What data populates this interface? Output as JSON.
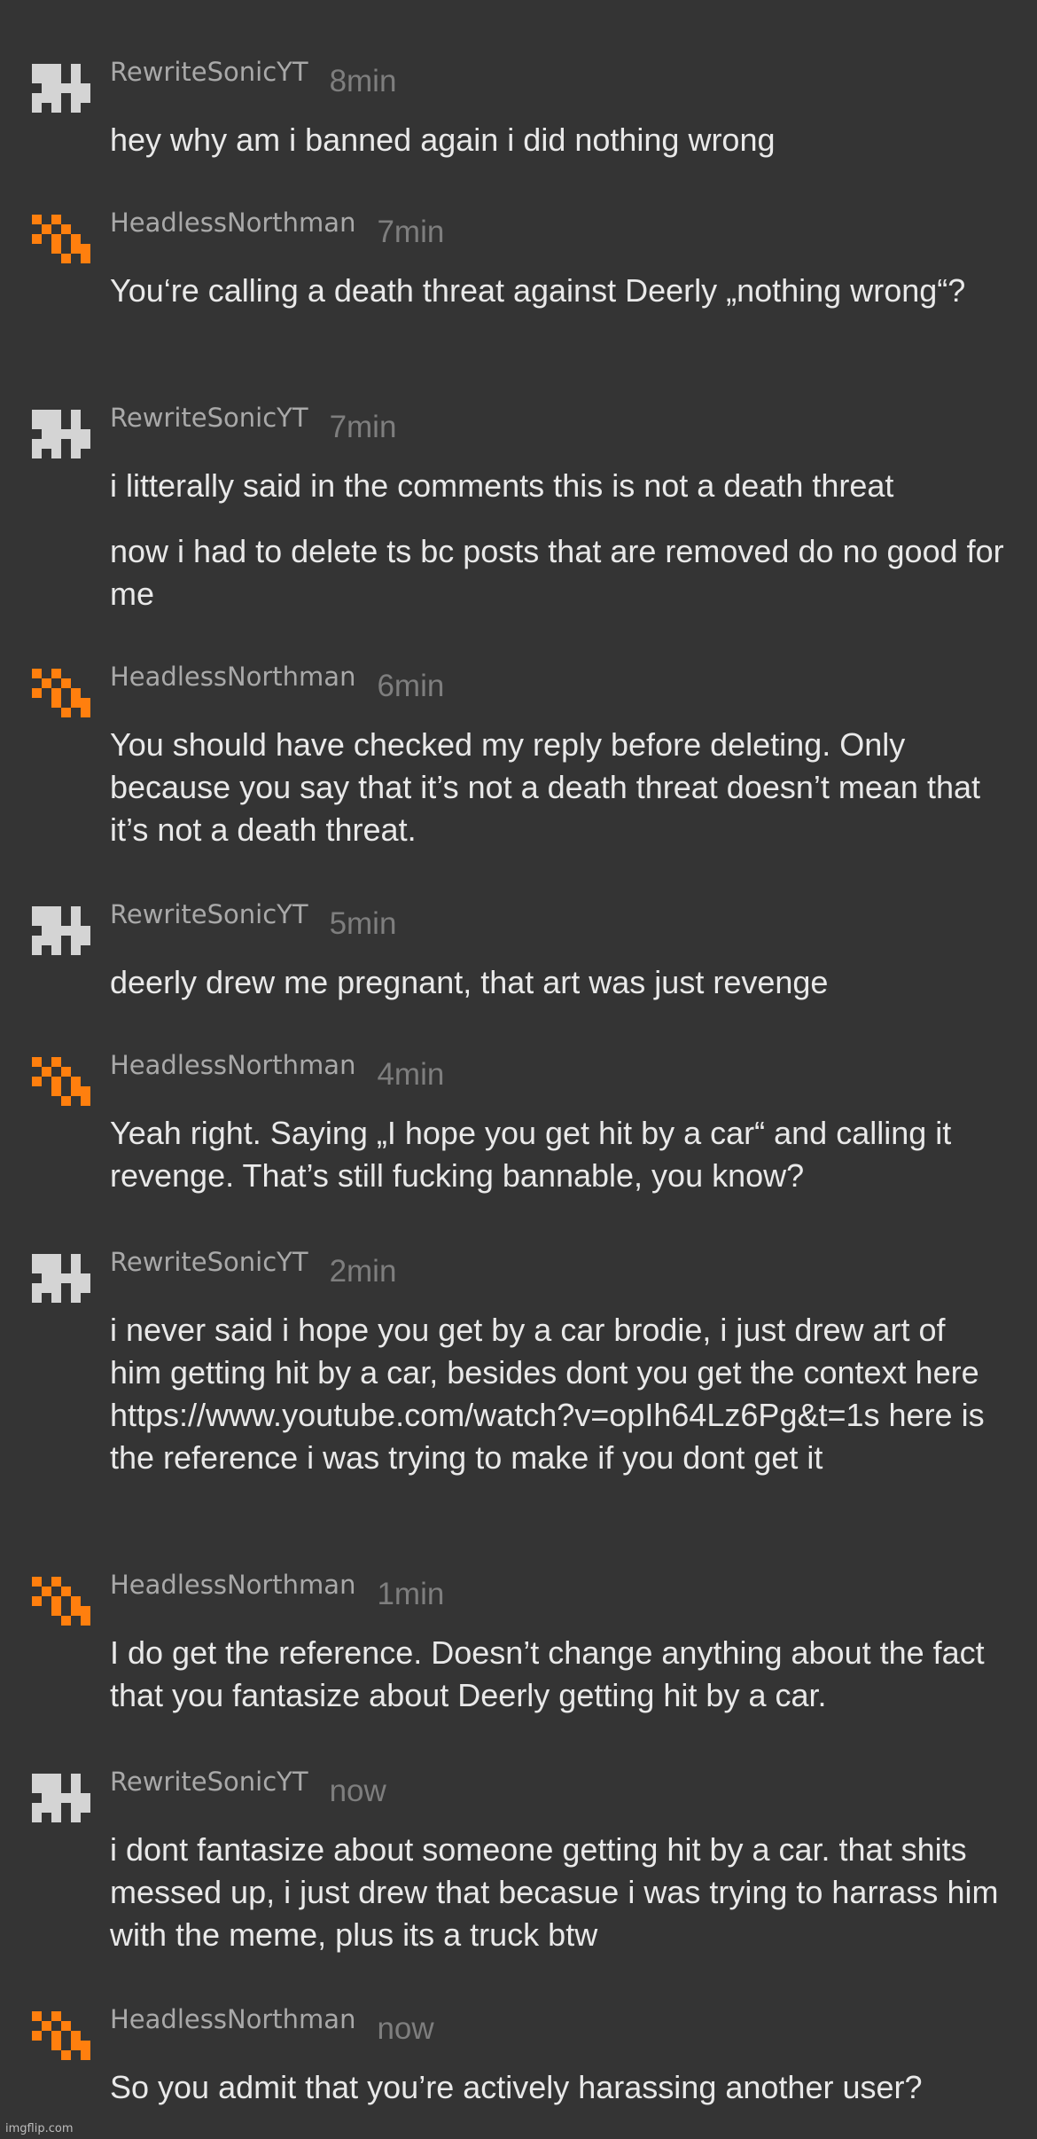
{
  "colors": {
    "background": "#343434",
    "username": "#a9a9a9",
    "timestamp": "#7e7e7e",
    "text": "#e9e9e9",
    "avatar_gray": "#d4d4d4",
    "avatar_orange": "#ff7f0e"
  },
  "comments": [
    {
      "user": "RewriteSonicYT",
      "time": "8min",
      "avatar_icon": "gray-pixel-avatar-icon",
      "paragraphs": [
        "hey why am i banned again i did nothing wrong"
      ]
    },
    {
      "user": "HeadlessNorthman",
      "time": "7min",
      "avatar_icon": "orange-pixel-avatar-icon",
      "paragraphs": [
        "You‘re calling a death threat against Deerly „nothing wrong“?"
      ]
    },
    {
      "user": "RewriteSonicYT",
      "time": "7min",
      "avatar_icon": "gray-pixel-avatar-icon",
      "paragraphs": [
        "i litterally said in the comments this is not a death threat",
        "now i had to delete ts bc posts that are removed do no good for me"
      ]
    },
    {
      "user": "HeadlessNorthman",
      "time": "6min",
      "avatar_icon": "orange-pixel-avatar-icon",
      "paragraphs": [
        "You should have checked my reply before deleting. Only because you say that it’s not a death threat doesn’t mean that it’s not a death threat."
      ]
    },
    {
      "user": "RewriteSonicYT",
      "time": "5min",
      "avatar_icon": "gray-pixel-avatar-icon",
      "paragraphs": [
        "deerly drew me pregnant, that art was just revenge"
      ]
    },
    {
      "user": "HeadlessNorthman",
      "time": "4min",
      "avatar_icon": "orange-pixel-avatar-icon",
      "paragraphs": [
        "Yeah right. Saying „I hope you get hit by a car“ and calling it revenge. That’s still fucking bannable, you know?"
      ]
    },
    {
      "user": "RewriteSonicYT",
      "time": "2min",
      "avatar_icon": "gray-pixel-avatar-icon",
      "paragraphs": [
        "i never said i hope you get by a car brodie, i just drew art of him getting hit by a car, besides dont you get the context here https://www.youtube.com/watch?v=opIh64Lz6Pg&t=1s here is the reference i was trying to make if you dont get it"
      ]
    },
    {
      "user": "HeadlessNorthman",
      "time": "1min",
      "avatar_icon": "orange-pixel-avatar-icon",
      "paragraphs": [
        "I do get the reference. Doesn’t change anything about the fact that you fantasize about Deerly getting hit by a car."
      ]
    },
    {
      "user": "RewriteSonicYT",
      "time": "now",
      "avatar_icon": "gray-pixel-avatar-icon",
      "paragraphs": [
        "i dont fantasize about someone getting hit by a car. that shits messed up, i just drew that becasue i was trying to harrass him with the meme, plus its a truck btw"
      ]
    },
    {
      "user": "HeadlessNorthman",
      "time": "now",
      "avatar_icon": "orange-pixel-avatar-icon",
      "paragraphs": [
        "So you admit that you’re actively harassing another user?"
      ]
    }
  ],
  "watermark": "imgflip.com"
}
